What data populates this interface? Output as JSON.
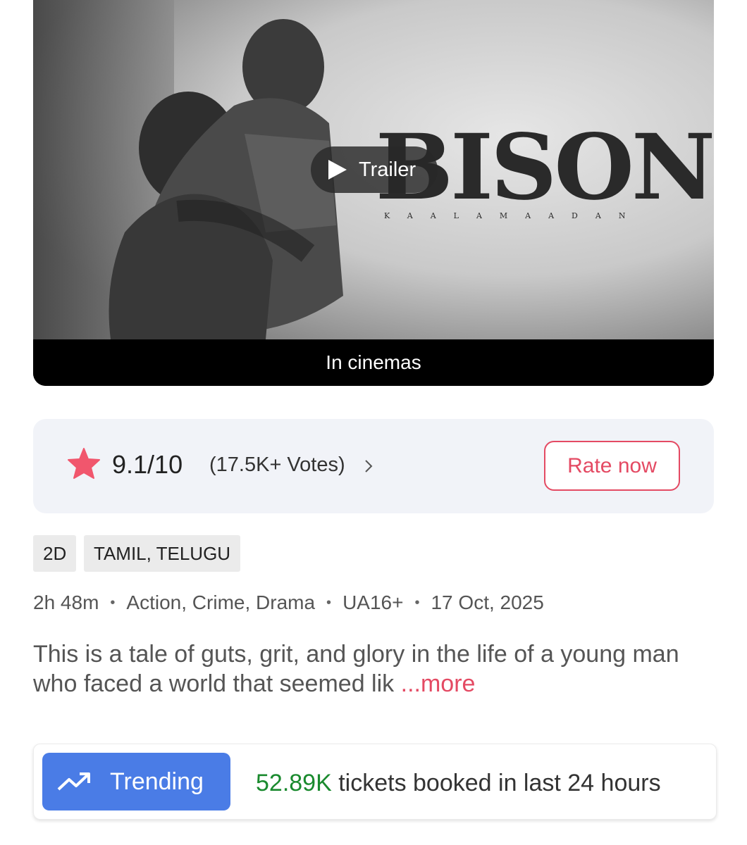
{
  "poster": {
    "title": "BISON",
    "subtitle": "KAALAMAADAN",
    "trailer_label": "Trailer",
    "status_label": "In cinemas"
  },
  "rating": {
    "score": "9.1/10",
    "votes": "(17.5K+ Votes)",
    "rate_button": "Rate now",
    "star_color": "#f1566d"
  },
  "tags": {
    "format": "2D",
    "languages": "TAMIL, TELUGU"
  },
  "meta": {
    "duration": "2h 48m",
    "genres": "Action, Crime, Drama",
    "certificate": "UA16+",
    "release_date": "17 Oct, 2025",
    "separator": "•"
  },
  "description": {
    "text": "This is a tale of guts, grit, and glory in the life of a young man who faced a world that seemed lik",
    "more_label": "...more"
  },
  "trending": {
    "badge_label": "Trending",
    "count": "52.89K",
    "text": "tickets booked in last 24 hours",
    "badge_color": "#4a7ce6",
    "count_color": "#1a8a2e"
  },
  "colors": {
    "accent": "#e44a63",
    "card_bg": "#f1f3f8"
  }
}
